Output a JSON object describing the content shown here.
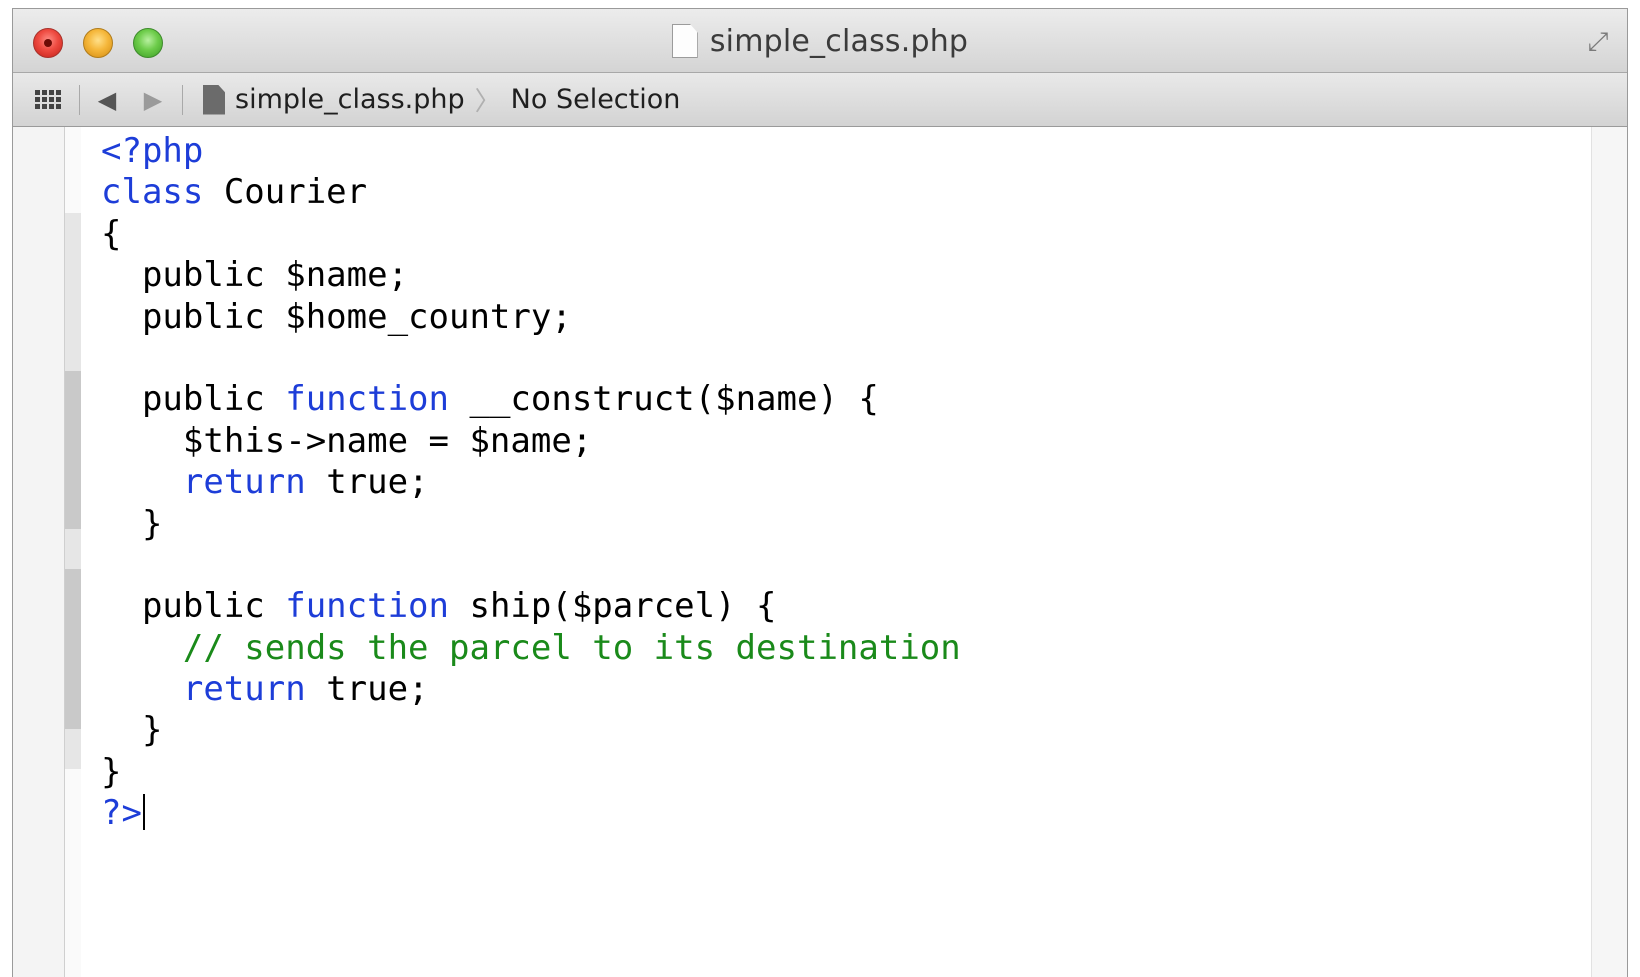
{
  "window": {
    "title": "simple_class.php"
  },
  "jumpbar": {
    "file_label": "simple_class.php",
    "separator": "〉",
    "selection_label": "No Selection",
    "back_glyph": "◀",
    "forward_glyph": "▶"
  },
  "icons": {
    "close": "close-button",
    "minimize": "minimize-button",
    "zoom": "zoom-button",
    "fullscreen": "fullscreen-icon",
    "related_items": "grid-icon",
    "document": "document-icon"
  },
  "colors": {
    "keyword": "#1d3dd8",
    "comment": "#1a8a1a",
    "text": "#000000"
  },
  "code": {
    "lines": [
      [
        {
          "t": "<?php",
          "c": "kw"
        }
      ],
      [
        {
          "t": "class",
          "c": "kw"
        },
        {
          "t": " Courier",
          "c": ""
        }
      ],
      [
        {
          "t": "{",
          "c": ""
        }
      ],
      [
        {
          "t": "  public $name;",
          "c": ""
        }
      ],
      [
        {
          "t": "  public $home_country;",
          "c": ""
        }
      ],
      [
        {
          "t": "",
          "c": ""
        }
      ],
      [
        {
          "t": "  public ",
          "c": ""
        },
        {
          "t": "function",
          "c": "kw"
        },
        {
          "t": " __construct($name) {",
          "c": ""
        }
      ],
      [
        {
          "t": "    $this->name = $name;",
          "c": ""
        }
      ],
      [
        {
          "t": "    ",
          "c": ""
        },
        {
          "t": "return",
          "c": "kw"
        },
        {
          "t": " true;",
          "c": ""
        }
      ],
      [
        {
          "t": "  }",
          "c": ""
        }
      ],
      [
        {
          "t": "",
          "c": ""
        }
      ],
      [
        {
          "t": "  public ",
          "c": ""
        },
        {
          "t": "function",
          "c": "kw"
        },
        {
          "t": " ship($parcel) {",
          "c": ""
        }
      ],
      [
        {
          "t": "    // sends the parcel to its destination",
          "c": "cm"
        }
      ],
      [
        {
          "t": "    ",
          "c": ""
        },
        {
          "t": "return",
          "c": "kw"
        },
        {
          "t": " true;",
          "c": ""
        }
      ],
      [
        {
          "t": "  }",
          "c": ""
        }
      ],
      [
        {
          "t": "}",
          "c": ""
        }
      ],
      [
        {
          "t": "?>",
          "c": "kw"
        }
      ]
    ],
    "caret_line": 16
  }
}
